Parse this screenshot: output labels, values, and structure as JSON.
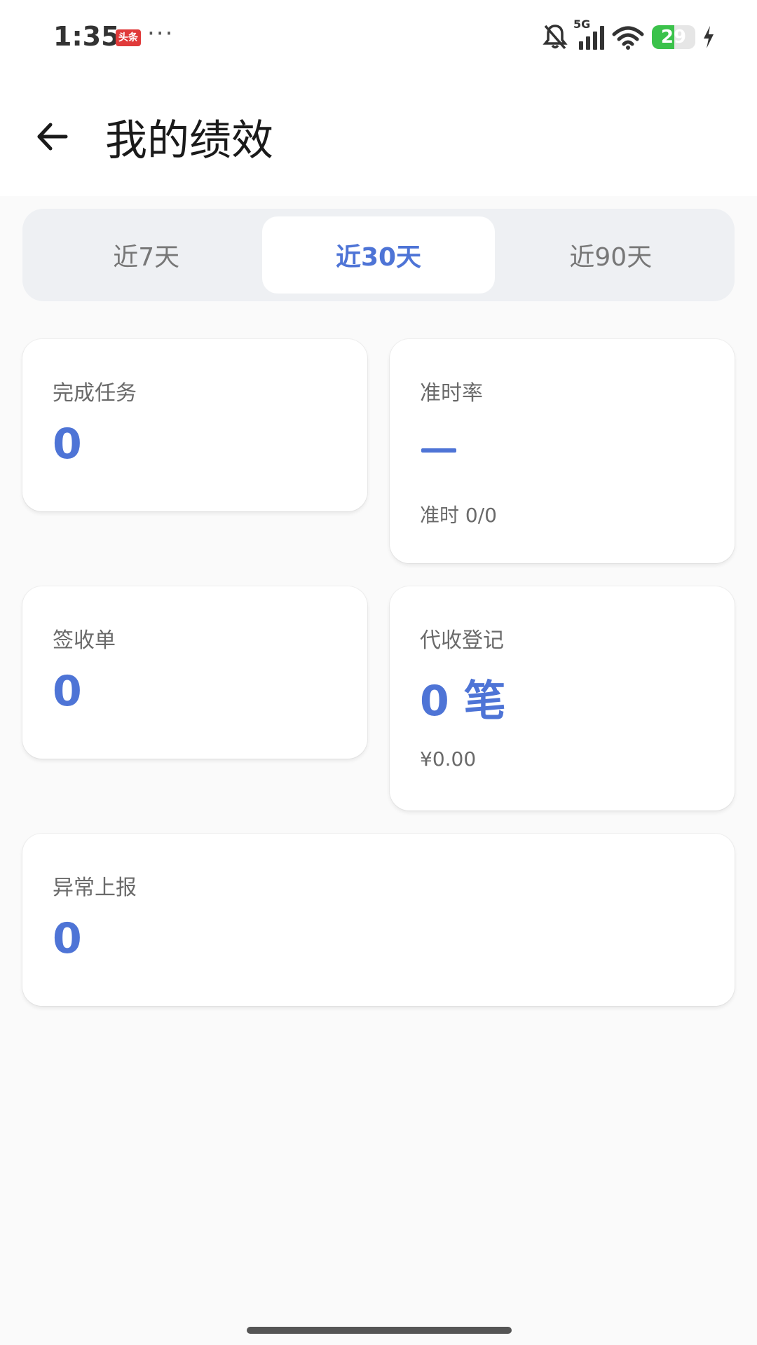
{
  "status_bar": {
    "time": "1:35",
    "badge": "头条",
    "more": "···",
    "battery": "29",
    "battery_level": 0.29,
    "network": "5G"
  },
  "header": {
    "title": "我的绩效",
    "back_icon": "arrow-left-icon"
  },
  "period_tabs": [
    {
      "label": "近7天",
      "active": false
    },
    {
      "label": "近30天",
      "active": true
    },
    {
      "label": "近90天",
      "active": false
    }
  ],
  "colors": {
    "accent": "#4e74d6",
    "background": "#fafafa",
    "card": "#ffffff",
    "segment_bg": "#eef0f3"
  },
  "stats": {
    "completed": {
      "label": "完成任务",
      "value": "0"
    },
    "ontime": {
      "label": "准时率",
      "value": "—",
      "sub": "准时 0/0"
    },
    "signed": {
      "label": "签收单",
      "value": "0"
    },
    "collection": {
      "label": "代收登记",
      "value": "0 笔",
      "sub": "¥0.00"
    },
    "exception": {
      "label": "异常上报",
      "value": "0"
    }
  }
}
